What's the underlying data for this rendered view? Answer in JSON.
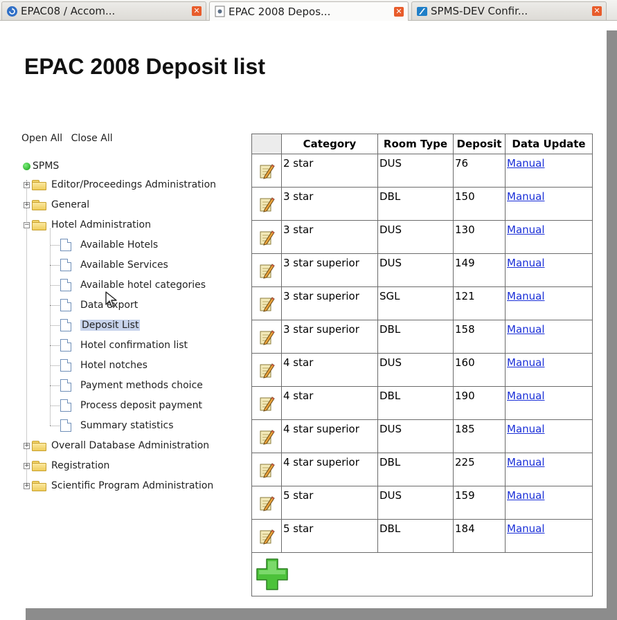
{
  "tabs": [
    {
      "label": "EPAC08 / Accom..."
    },
    {
      "label": "EPAC 2008 Depos..."
    },
    {
      "label": "SPMS-DEV Confir..."
    }
  ],
  "page": {
    "title": "EPAC 2008 Deposit list"
  },
  "tree": {
    "open_all": "Open All",
    "close_all": "Close All",
    "root": "SPMS",
    "folders_top": [
      "Editor/Proceedings Administration",
      "General",
      "Hotel Administration"
    ],
    "hotel_items": [
      "Available Hotels",
      "Available Services",
      "Available hotel categories",
      "Data export",
      "Deposit List",
      "Hotel confirmation list",
      "Hotel notches",
      "Payment methods choice",
      "Process deposit payment",
      "Summary statistics"
    ],
    "folders_bottom": [
      "Overall Database Administration",
      "Registration",
      "Scientific Program Administration"
    ]
  },
  "table": {
    "headers": [
      "Category",
      "Room Type",
      "Deposit",
      "Data Update"
    ],
    "rows": [
      [
        "2 star",
        "DUS",
        "76",
        "Manual"
      ],
      [
        "3 star",
        "DBL",
        "150",
        "Manual"
      ],
      [
        "3 star",
        "DUS",
        "130",
        "Manual"
      ],
      [
        "3 star superior",
        "DUS",
        "149",
        "Manual"
      ],
      [
        "3 star superior",
        "SGL",
        "121",
        "Manual"
      ],
      [
        "3 star superior",
        "DBL",
        "158",
        "Manual"
      ],
      [
        "4 star",
        "DUS",
        "160",
        "Manual"
      ],
      [
        "4 star",
        "DBL",
        "190",
        "Manual"
      ],
      [
        "4 star superior",
        "DUS",
        "185",
        "Manual"
      ],
      [
        "4 star superior",
        "DBL",
        "225",
        "Manual"
      ],
      [
        "5 star",
        "DUS",
        "159",
        "Manual"
      ],
      [
        "5 star",
        "DBL",
        "184",
        "Manual"
      ]
    ]
  },
  "colors": {
    "link": "#1a2fd8",
    "selected_bg": "#c7d3ec",
    "add_green": "#4cc23a"
  }
}
